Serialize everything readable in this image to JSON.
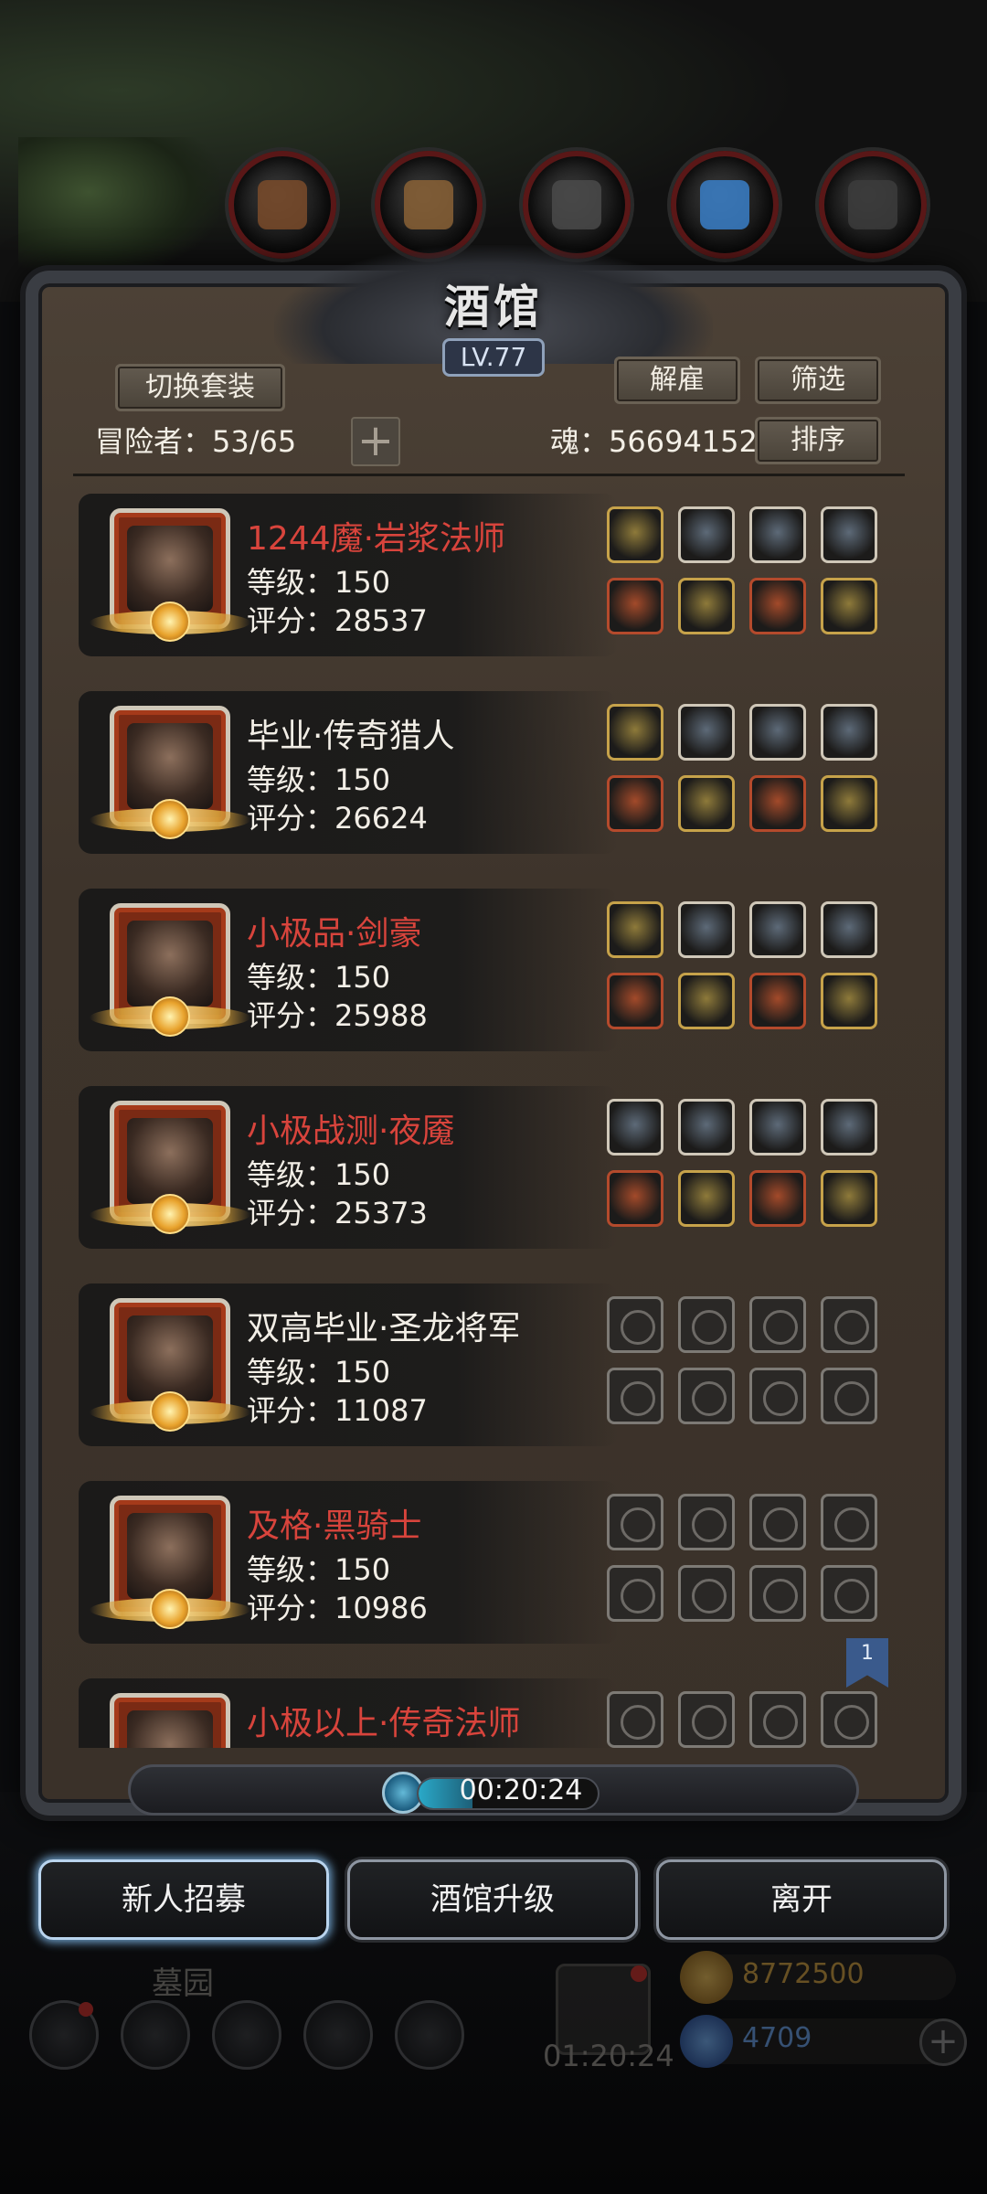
{
  "tavern": {
    "title": "酒馆",
    "level": "LV.77",
    "switch_outfit": "切换套装",
    "dismiss": "解雇",
    "filter": "筛选",
    "sort": "排序",
    "adventurers_label": "冒险者：53/65",
    "add": "+",
    "soul_label": "魂：56694152"
  },
  "adventurers": [
    {
      "name": "1244魔·岩浆法师",
      "name_color": "red",
      "level": "等级：150",
      "score": "评分：28537",
      "slots": [
        {
          "state": "filled",
          "frame": "gold"
        },
        {
          "state": "filled",
          "frame": "silver"
        },
        {
          "state": "filled",
          "frame": "silver"
        },
        {
          "state": "filled",
          "frame": "silver"
        },
        {
          "state": "filled",
          "frame": "red"
        },
        {
          "state": "filled",
          "frame": "gold"
        },
        {
          "state": "filled",
          "frame": "red"
        },
        {
          "state": "filled",
          "frame": "gold"
        }
      ]
    },
    {
      "name": "毕业·传奇猎人",
      "name_color": "white",
      "level": "等级：150",
      "score": "评分：26624",
      "slots": [
        {
          "state": "filled",
          "frame": "gold"
        },
        {
          "state": "filled",
          "frame": "silver"
        },
        {
          "state": "filled",
          "frame": "silver"
        },
        {
          "state": "filled",
          "frame": "silver"
        },
        {
          "state": "filled",
          "frame": "red"
        },
        {
          "state": "filled",
          "frame": "gold"
        },
        {
          "state": "filled",
          "frame": "red"
        },
        {
          "state": "filled",
          "frame": "gold"
        }
      ]
    },
    {
      "name": "小极品·剑豪",
      "name_color": "red",
      "level": "等级：150",
      "score": "评分：25988",
      "slots": [
        {
          "state": "filled",
          "frame": "gold"
        },
        {
          "state": "filled",
          "frame": "silver"
        },
        {
          "state": "filled",
          "frame": "silver"
        },
        {
          "state": "filled",
          "frame": "silver"
        },
        {
          "state": "filled",
          "frame": "red"
        },
        {
          "state": "filled",
          "frame": "gold"
        },
        {
          "state": "filled",
          "frame": "red"
        },
        {
          "state": "filled",
          "frame": "gold"
        }
      ]
    },
    {
      "name": "小极战测·夜魇",
      "name_color": "red",
      "level": "等级：150",
      "score": "评分：25373",
      "slots": [
        {
          "state": "filled",
          "frame": "silver"
        },
        {
          "state": "filled",
          "frame": "silver"
        },
        {
          "state": "filled",
          "frame": "silver"
        },
        {
          "state": "filled",
          "frame": "silver"
        },
        {
          "state": "filled",
          "frame": "red"
        },
        {
          "state": "filled",
          "frame": "gold"
        },
        {
          "state": "filled",
          "frame": "red"
        },
        {
          "state": "filled",
          "frame": "gold"
        }
      ]
    },
    {
      "name": "双高毕业·圣龙将军",
      "name_color": "white",
      "level": "等级：150",
      "score": "评分：11087",
      "slots": [
        {
          "state": "empty"
        },
        {
          "state": "empty"
        },
        {
          "state": "empty"
        },
        {
          "state": "empty"
        },
        {
          "state": "empty"
        },
        {
          "state": "empty"
        },
        {
          "state": "empty"
        },
        {
          "state": "empty"
        }
      ]
    },
    {
      "name": "及格·黑骑士",
      "name_color": "red",
      "level": "等级：150",
      "score": "评分：10986",
      "slots": [
        {
          "state": "empty"
        },
        {
          "state": "empty"
        },
        {
          "state": "empty"
        },
        {
          "state": "empty"
        },
        {
          "state": "empty"
        },
        {
          "state": "empty"
        },
        {
          "state": "empty"
        },
        {
          "state": "empty"
        }
      ]
    },
    {
      "name": "小极以上·传奇法师",
      "name_color": "red",
      "level": "",
      "score": "",
      "slots": [
        {
          "state": "empty"
        },
        {
          "state": "empty"
        },
        {
          "state": "empty"
        },
        {
          "state": "empty"
        }
      ]
    }
  ],
  "page_flag": "1",
  "timer": {
    "value": "00:20:24",
    "progress": 0.3
  },
  "actions": {
    "recruit": "新人招募",
    "upgrade": "酒馆升级",
    "leave": "离开"
  },
  "background": {
    "graveyard_label": "墓园",
    "gift_timer": "01:20:24",
    "gold": "8772500",
    "gems": "4709"
  },
  "colors": {
    "red_name": "#d8443c",
    "white_name": "#f2eee6",
    "accent": "#6d9ec8"
  }
}
